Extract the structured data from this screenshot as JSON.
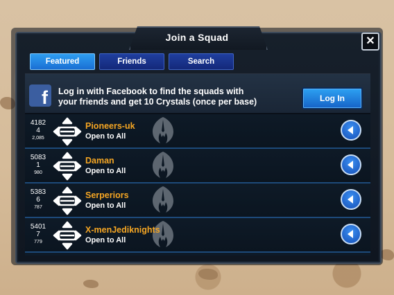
{
  "dialog": {
    "title": "Join a Squad",
    "close_label": "✕"
  },
  "tabs": [
    {
      "label": "Featured",
      "active": true
    },
    {
      "label": "Friends",
      "active": false
    },
    {
      "label": "Search",
      "active": false
    }
  ],
  "facebook": {
    "icon_letter": "f",
    "message_line1": "Log in with Facebook to find the squads with",
    "message_line2": "your friends and get 10 Crystals (once per base)",
    "login_label": "Log In"
  },
  "squads": [
    {
      "rank": "4182",
      "members": "4",
      "reputation": "2,085",
      "name": "Pioneers-uk",
      "status": "Open to All"
    },
    {
      "rank": "5083",
      "members": "1",
      "reputation": "980",
      "name": "Daman",
      "status": "Open to All"
    },
    {
      "rank": "5383",
      "members": "6",
      "reputation": "787",
      "name": "Serperiors",
      "status": "Open to All"
    },
    {
      "rank": "5401",
      "members": "7",
      "reputation": "779",
      "name": "X-menJediknights",
      "status": "Open to All"
    }
  ],
  "colors": {
    "accent_blue": "#2e9ef1",
    "squad_name": "#f5a623",
    "facebook_blue": "#3b5ea0"
  }
}
